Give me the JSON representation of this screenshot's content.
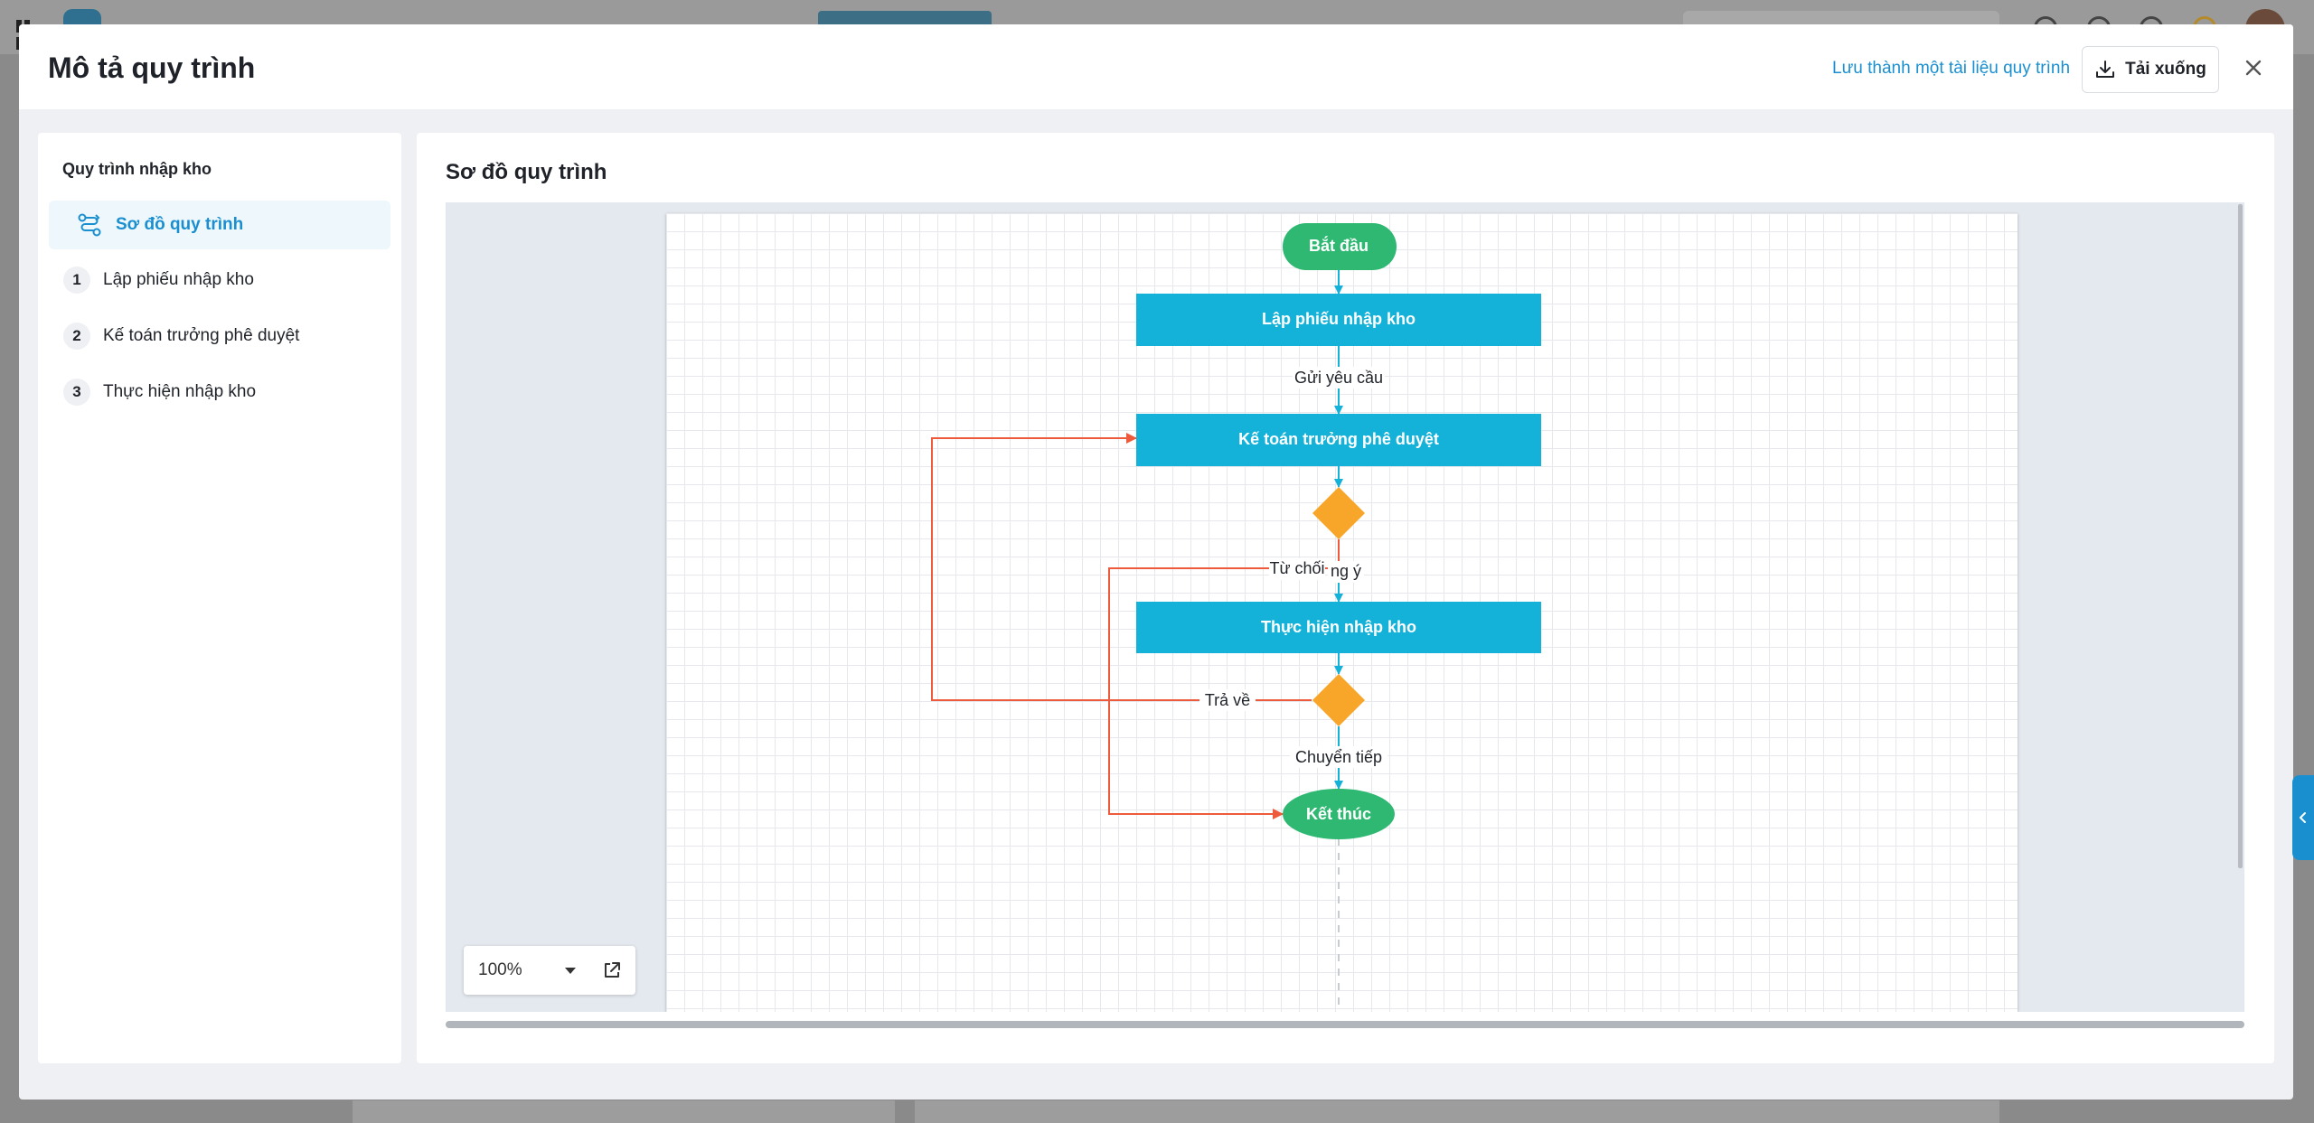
{
  "modal": {
    "title": "Mô tả quy trình",
    "save_as_doc": "Lưu thành một tài liệu quy trình",
    "download_label": "Tải xuống"
  },
  "sidebar": {
    "process_name": "Quy trình nhập kho",
    "items": [
      {
        "label": "Sơ đồ quy trình",
        "active": true,
        "icon": "flow-diagram-icon"
      },
      {
        "num": "1",
        "label": "Lập phiếu nhập kho"
      },
      {
        "num": "2",
        "label": "Kế toán trưởng phê duyệt"
      },
      {
        "num": "3",
        "label": "Thực hiện nhập kho"
      }
    ]
  },
  "main": {
    "section_title": "Sơ đồ quy trình",
    "zoom": "100%"
  },
  "diagram": {
    "nodes": {
      "start": "Bắt đầu",
      "step1": "Lập phiếu nhập kho",
      "step2": "Kế toán trưởng phê duyệt",
      "step3": "Thực hiện nhập kho",
      "end": "Kết thúc"
    },
    "edges": {
      "send_request": "Gửi yêu cầu",
      "reject": "Từ chối",
      "approve": "ng ý",
      "return": "Trả về",
      "forward": "Chuyển tiếp"
    }
  },
  "colors": {
    "accent": "#1a8fd0",
    "start_end": "#2eb872",
    "task": "#14b1d9",
    "decision": "#f7a62a",
    "back_edge": "#ee5a3c"
  }
}
